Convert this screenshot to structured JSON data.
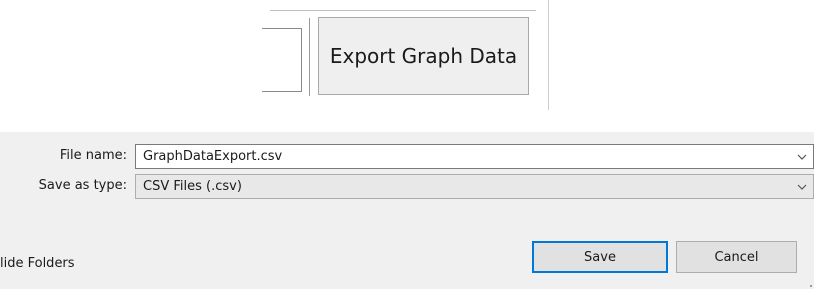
{
  "toolbar": {
    "export_button_label": "Export Graph Data"
  },
  "dialog": {
    "file_name_label": "File name:",
    "file_name_value": "GraphDataExport.csv",
    "save_type_label": "Save as type:",
    "save_type_value": "CSV Files (.csv)",
    "hide_folders_label": "lide Folders",
    "save_label": "Save",
    "cancel_label": "Cancel"
  },
  "icons": {
    "file_name_dropdown": "chevron-down-icon",
    "save_type_dropdown": "chevron-down-icon"
  },
  "colors": {
    "dialog_background": "#f0f0f0",
    "default_button_border": "#0078d7",
    "button_background": "#e1e1e1"
  }
}
